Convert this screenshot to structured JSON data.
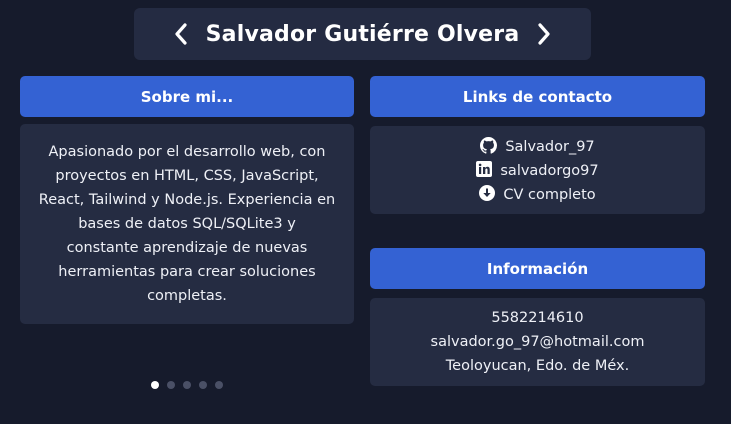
{
  "header": {
    "title": "Salvador Gutiérre Olvera"
  },
  "about": {
    "heading": "Sobre mi...",
    "lines": [
      "Apasionado por el desarrollo web, con",
      "proyectos en HTML, CSS, JavaScript,",
      "React, Tailwind y Node.js. Experiencia en",
      "bases de datos SQL/SQLite3 y",
      "constante aprendizaje de nuevas",
      "herramientas para crear soluciones",
      "completas."
    ]
  },
  "contact": {
    "heading": "Links de contacto",
    "links": [
      {
        "icon": "github-icon",
        "label": "Salvador_97"
      },
      {
        "icon": "linkedin-icon",
        "label": "salvadorgo97"
      },
      {
        "icon": "download-icon",
        "label": "CV completo"
      }
    ]
  },
  "info": {
    "heading": "Información",
    "phone": "5582214610",
    "email": "salvador.go_97@hotmail.com",
    "location": "Teoloyucan, Edo. de Méx."
  },
  "carousel": {
    "total_slides": 5,
    "active_index": 0
  },
  "colors": {
    "background": "#161b2c",
    "card": "#252c42",
    "accent": "#3462d3"
  }
}
